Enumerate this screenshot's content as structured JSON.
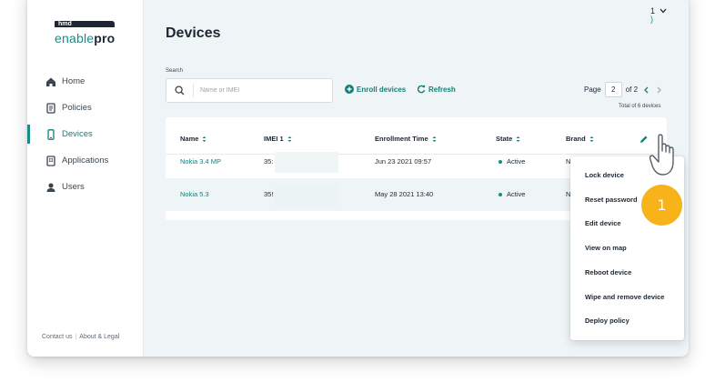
{
  "brand": {
    "top": "hmd",
    "name_light": "enable",
    "name_bold": "pro"
  },
  "header": {
    "fragment_top": "1",
    "fragment_bottom": ")"
  },
  "sidebar": {
    "items": [
      {
        "label": "Home",
        "icon": "home-icon"
      },
      {
        "label": "Policies",
        "icon": "document-icon"
      },
      {
        "label": "Devices",
        "icon": "phone-icon",
        "active": true
      },
      {
        "label": "Applications",
        "icon": "app-icon"
      },
      {
        "label": "Users",
        "icon": "user-icon"
      }
    ],
    "footer": {
      "contact": "Contact us",
      "separator": "|",
      "legal": "About & Legal"
    }
  },
  "main": {
    "title": "Devices",
    "search": {
      "label": "Search",
      "placeholder": "Name or IMEI"
    },
    "actions": {
      "enroll": "Enroll devices",
      "refresh": "Refresh"
    },
    "pager": {
      "prefix": "Page",
      "current": "2",
      "of": "of 2"
    },
    "total": "Total of 6 devices",
    "table": {
      "columns": [
        "Name",
        "IMEI 1",
        "Enrollment Time",
        "State",
        "Brand"
      ],
      "rows": [
        {
          "name": "Nokia 3.4 MP",
          "imei": "35:",
          "enrollment": "Jun 23 2021 09:57",
          "state": "Active",
          "brand": "N"
        },
        {
          "name": "Nokia 5.3",
          "imei": "35!",
          "enrollment": "May 28 2021 13:40",
          "state": "Active",
          "brand": "N"
        }
      ]
    }
  },
  "menu": {
    "items": [
      "Lock device",
      "Reset password",
      "Edit device",
      "View on map",
      "Reboot device",
      "Wipe and remove device",
      "Deploy policy"
    ]
  },
  "step_badge": "1",
  "colors": {
    "accent": "#1a8c86",
    "badge": "#f8b21a",
    "background": "#eff5f7"
  }
}
